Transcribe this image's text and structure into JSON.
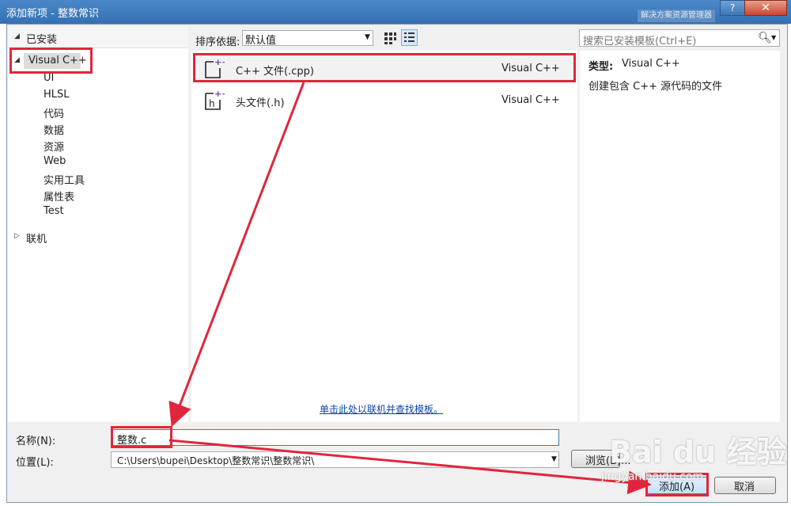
{
  "window": {
    "title": "添加新项 - 整数常识",
    "help": "?",
    "close": "✕",
    "background_hint": "解决方案资源管理器"
  },
  "left": {
    "installed": "已安装",
    "selected": "Visual C++",
    "children": [
      "UI",
      "HLSL",
      "代码",
      "数据",
      "资源",
      "Web",
      "实用工具",
      "属性表",
      "Test"
    ],
    "online": "联机"
  },
  "toolbar": {
    "sort_label": "排序依据:",
    "sort_value": "默认值",
    "search_placeholder": "搜索已安装模板(Ctrl+E)"
  },
  "templates": [
    {
      "name": "C++ 文件(.cpp)",
      "category": "Visual C++",
      "icon": "cpp-file-icon"
    },
    {
      "name": "头文件(.h)",
      "category": "Visual C++",
      "icon": "header-file-icon"
    }
  ],
  "online_link": "单击此处以联机并查找模板。",
  "details": {
    "type_key": "类型:",
    "type_value": "Visual C++",
    "description": "创建包含 C++ 源代码的文件"
  },
  "form": {
    "name_label": "名称(N):",
    "name_value": "整数.c",
    "location_label": "位置(L):",
    "location_value": "C:\\Users\\bupei\\Desktop\\整数常识\\整数常识\\"
  },
  "buttons": {
    "browse": "浏览(B)...",
    "add": "添加(A)",
    "cancel": "取消"
  },
  "watermark": {
    "brand": "Bai du 经验",
    "url": "jingyan.baidu.com"
  },
  "colors": {
    "highlight": "#e0263c",
    "accent": "#3c7fb1",
    "link": "#0645ad"
  }
}
